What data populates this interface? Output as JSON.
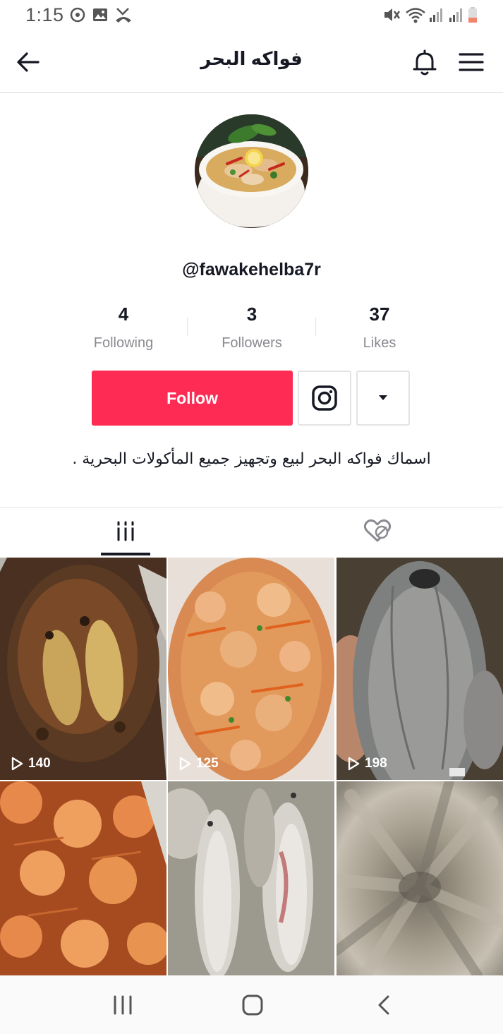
{
  "status_bar": {
    "time": "1:15",
    "left_icons": [
      "sync-icon",
      "gallery-icon",
      "missed-call-icon"
    ],
    "right_icons": [
      "mute-icon",
      "wifi-icon",
      "signal-icon",
      "signal-icon",
      "battery-icon"
    ]
  },
  "header": {
    "title": "فواكه البحر",
    "icons": [
      "back-arrow-icon",
      "bell-icon",
      "menu-icon"
    ]
  },
  "profile": {
    "username": "@fawakehelba7r",
    "stats": [
      {
        "value": "4",
        "label": "Following"
      },
      {
        "value": "3",
        "label": "Followers"
      },
      {
        "value": "37",
        "label": "Likes"
      }
    ],
    "follow_label": "Follow",
    "bio": "اسماك فواكه البحر لبيع وتجهيز جميع المأكولات البحرية ."
  },
  "tabs": [
    {
      "name": "videos",
      "icon": "grid-icon",
      "active": true
    },
    {
      "name": "liked",
      "icon": "hidden-likes-icon",
      "active": false
    }
  ],
  "videos": [
    {
      "views": "140"
    },
    {
      "views": "125"
    },
    {
      "views": "198"
    },
    {
      "views": ""
    },
    {
      "views": ""
    },
    {
      "views": ""
    }
  ],
  "colors": {
    "accent": "#fe2c55",
    "text": "#161823",
    "muted": "#8a8b91",
    "divider": "#e3e3e4"
  }
}
